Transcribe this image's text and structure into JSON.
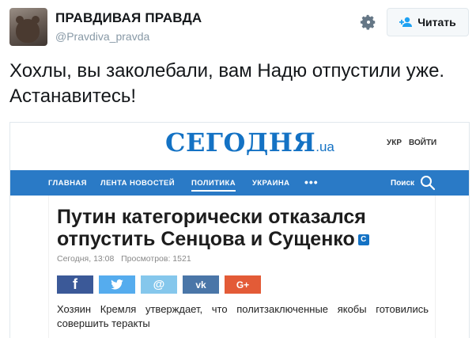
{
  "tweet": {
    "display_name": "ПРАВДИВАЯ ПРАВДА",
    "username": "@Pravdiva_pravda",
    "follow_label": "Читать",
    "text": "Хохлы, вы заколебали, вам Надю отпустили уже. Астанавитесь!"
  },
  "site": {
    "logo_main": "СЕГОДНЯ",
    "logo_tld": ".ua",
    "lang": "УКР",
    "login": "ВОЙТИ",
    "nav": [
      "ГЛАВНАЯ",
      "ЛЕНТА НОВОСТЕЙ",
      "ПОЛИТИКА",
      "УКРАИНА"
    ],
    "nav_more": "•••",
    "search_label": "Поиск"
  },
  "article": {
    "headline": "Путин категорически отказался отпустить Сенцова и Сущенко",
    "badge": "С",
    "meta": "Сегодня, 13:08   Просмотров: 1521",
    "share": {
      "facebook": "f",
      "twitter": "",
      "mail": "@",
      "vk": "vk",
      "gplus": "G+"
    },
    "lede": "Хозяин Кремля утверждает, что политзаключенные якобы готовились совершить теракты"
  },
  "colors": {
    "site_blue": "#1472c4",
    "nav_blue": "#2a7ac6",
    "muted": "#8899a6"
  },
  "icons": [
    "gear-icon",
    "follow-user-icon",
    "search-icon",
    "twitter-bird-icon"
  ]
}
